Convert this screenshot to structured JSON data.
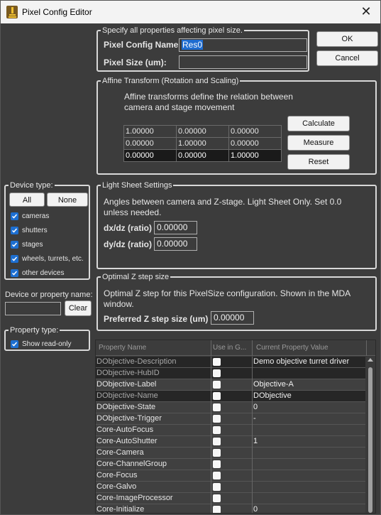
{
  "window": {
    "title": "Pixel Config Editor",
    "close_glyph": "✕"
  },
  "pixel": {
    "legend": "Specify all properties affecting pixel size.",
    "config_name_label": "Pixel Config Name:",
    "config_name_value": "Res0",
    "pixel_size_label": "Pixel Size (um):",
    "pixel_size_value": ""
  },
  "dialog_buttons": {
    "ok": "OK",
    "cancel": "Cancel"
  },
  "affine": {
    "legend": "Affine Transform (Rotation and Scaling)",
    "desc_line1": "Affine transforms define the relation between",
    "desc_line2": "camera and stage movement",
    "matrix": [
      [
        "1.00000",
        "0.00000",
        "0.00000"
      ],
      [
        "0.00000",
        "1.00000",
        "0.00000"
      ],
      [
        "0.00000",
        "0.00000",
        "1.00000"
      ]
    ],
    "calculate": "Calculate",
    "measure": "Measure",
    "reset": "Reset"
  },
  "lightsheet": {
    "legend": "Light Sheet Settings",
    "desc_line1": "Angles between camera and Z-stage. Light Sheet Only. Set 0.0",
    "desc_line2": "unless needed.",
    "dxdz_label": "dx/dz (ratio)",
    "dxdz_value": "0.00000",
    "dydz_label": "dy/dz (ratio)",
    "dydz_value": "0.00000"
  },
  "zstep": {
    "legend": "Optimal Z step size",
    "desc_line1": "Optimal Z step for this PixelSize configuration. Shown in the MDA",
    "desc_line2": "window.",
    "pref_label": "Preferred Z step size (um)",
    "pref_value": "0.00000"
  },
  "device_type": {
    "legend": "Device type:",
    "all": "All",
    "none": "None",
    "items": [
      "cameras",
      "shutters",
      "stages",
      "wheels, turrets, etc.",
      "other devices"
    ]
  },
  "filter": {
    "label": "Device or property name:",
    "value": "",
    "clear": "Clear"
  },
  "property_type": {
    "legend": "Property type:",
    "show_readonly": "Show read-only"
  },
  "props": {
    "headers": [
      "Property Name",
      "Use in G...",
      "Current Property Value"
    ],
    "rows": [
      {
        "name": "DObjective-Description",
        "value": "Demo objective turret driver"
      },
      {
        "name": "DObjective-HubID",
        "value": ""
      },
      {
        "name": "DObjective-Label",
        "value": "Objective-A"
      },
      {
        "name": "DObjective-Name",
        "value": "DObjective"
      },
      {
        "name": "DObjective-State",
        "value": "0"
      },
      {
        "name": "DObjective-Trigger",
        "value": "-"
      },
      {
        "name": "Core-AutoFocus",
        "value": ""
      },
      {
        "name": "Core-AutoShutter",
        "value": "1"
      },
      {
        "name": "Core-Camera",
        "value": ""
      },
      {
        "name": "Core-ChannelGroup",
        "value": ""
      },
      {
        "name": "Core-Focus",
        "value": ""
      },
      {
        "name": "Core-Galvo",
        "value": ""
      },
      {
        "name": "Core-ImageProcessor",
        "value": ""
      },
      {
        "name": "Core-Initialize",
        "value": "0"
      }
    ]
  },
  "colors": {
    "accent": "#1e6cd0",
    "background": "#3c3c3c"
  }
}
